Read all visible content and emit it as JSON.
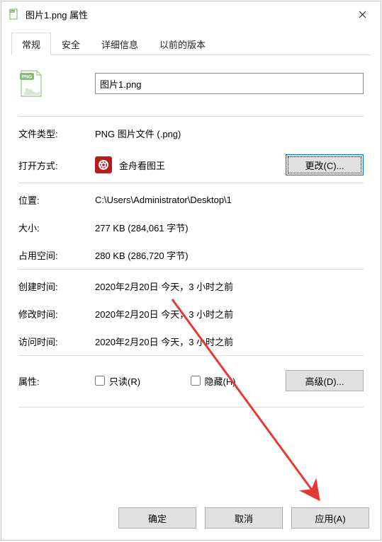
{
  "title": "图片1.png 属性",
  "tabs": {
    "general": "常规",
    "security": "安全",
    "details": "详细信息",
    "previous": "以前的版本"
  },
  "filename": "图片1.png",
  "labels": {
    "filetype": "文件类型:",
    "openwith": "打开方式:",
    "location": "位置:",
    "size": "大小:",
    "sizeondisk": "占用空间:",
    "created": "创建时间:",
    "modified": "修改时间:",
    "accessed": "访问时间:",
    "attributes": "属性:"
  },
  "values": {
    "filetype": "PNG 图片文件 (.png)",
    "openwith_app": "金舟看图王",
    "location": "C:\\Users\\Administrator\\Desktop\\1",
    "size": "277 KB (284,061 字节)",
    "sizeondisk": "280 KB (286,720 字节)",
    "created": "2020年2月20日 今天，3 小时之前",
    "modified": "2020年2月20日 今天，3 小时之前",
    "accessed": "2020年2月20日 今天，3 小时之前"
  },
  "buttons": {
    "change": "更改(C)...",
    "advanced": "高级(D)...",
    "ok": "确定",
    "cancel": "取消",
    "apply": "应用(A)"
  },
  "checkboxes": {
    "readonly": "只读(R)",
    "hidden": "隐藏(H)"
  }
}
